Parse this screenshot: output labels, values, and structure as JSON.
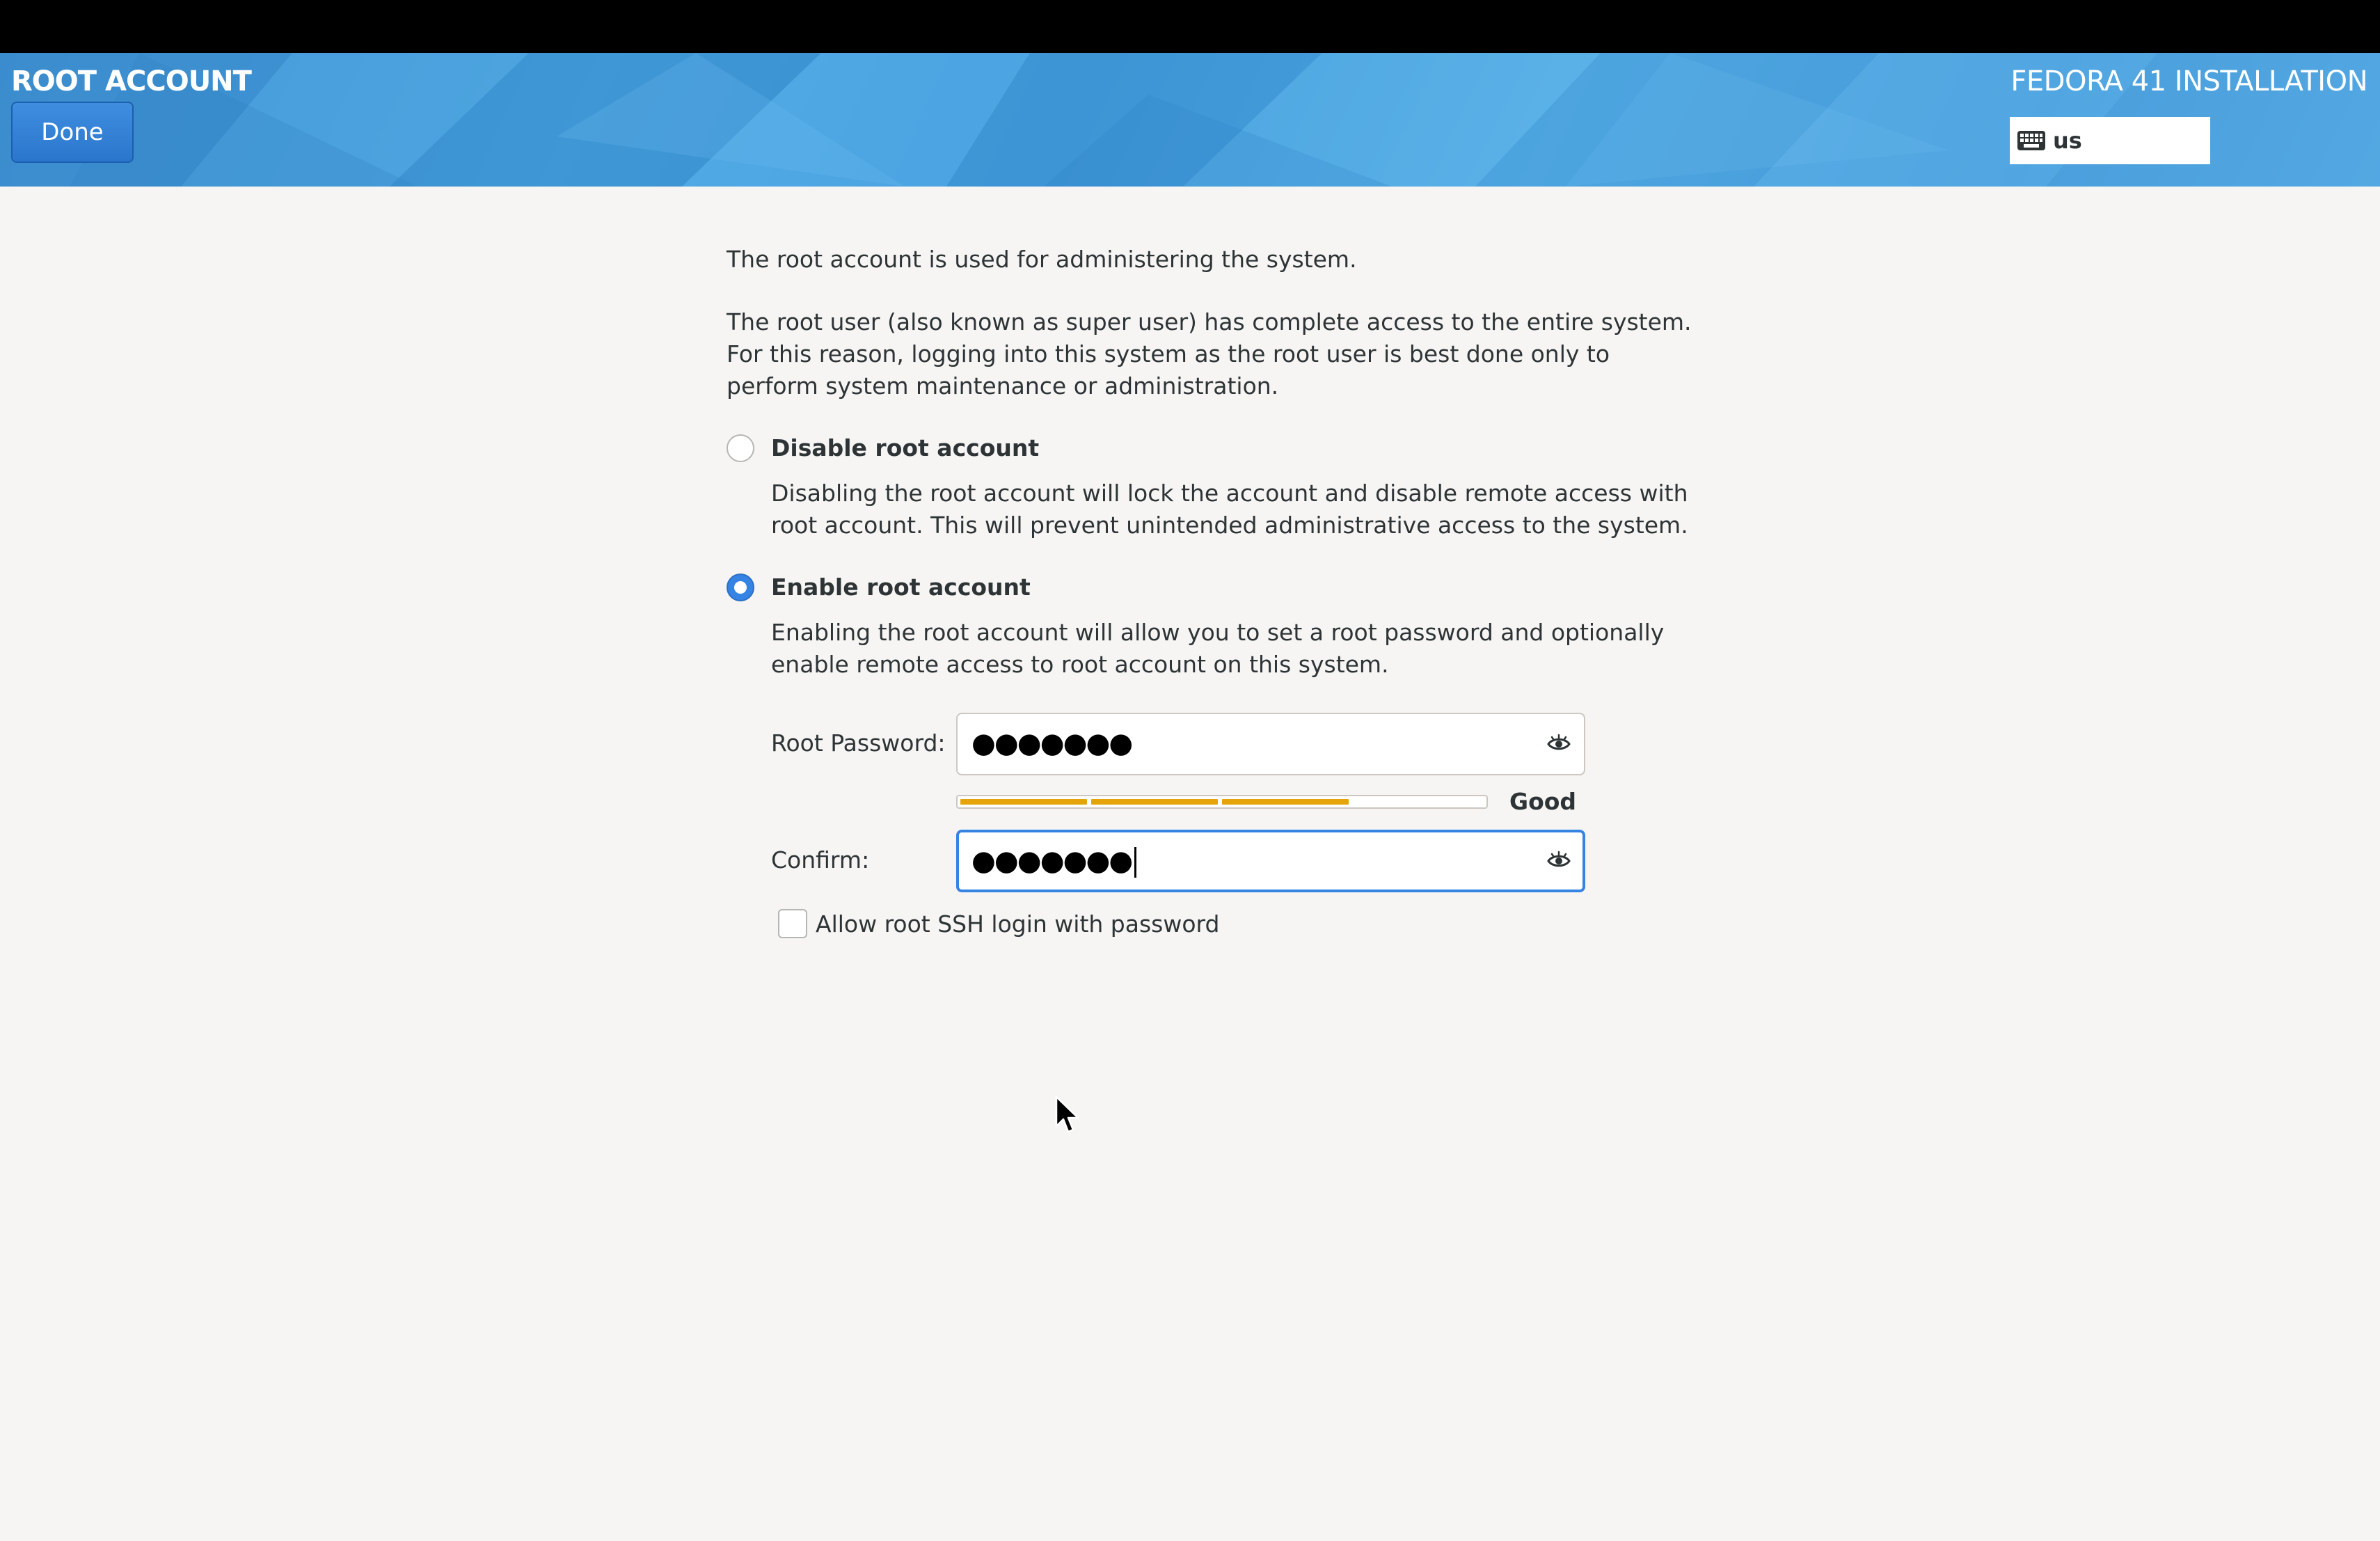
{
  "header": {
    "title": "ROOT ACCOUNT",
    "done_label": "Done",
    "installation_title": "FEDORA 41 INSTALLATION",
    "keyboard_layout": "us",
    "keyboard_icon": "keyboard-icon"
  },
  "intro": {
    "line1": "The root account is used for administering the system.",
    "para2_line1": "The root user (also known as super user) has complete access to the entire system.",
    "para2_line2": "For this reason, logging into this system as the root user is best done only to",
    "para2_line3": "perform system maintenance or administration."
  },
  "options": {
    "disable": {
      "label": "Disable root account",
      "selected": false,
      "desc_line1": "Disabling the root account will lock the account and disable remote access with",
      "desc_line2": "root account. This will prevent unintended administrative access to the system."
    },
    "enable": {
      "label": "Enable root account",
      "selected": true,
      "desc_line1": "Enabling the root account will allow you to set a root password and optionally",
      "desc_line2": "enable remote access to root account on this system."
    }
  },
  "password": {
    "label": "Root Password:",
    "masked_value": "●●●●●●●",
    "strength_label": "Good",
    "strength_segments_filled": 3,
    "strength_segments_total": 4,
    "strength_color": "#e5a50a",
    "reveal_icon": "eye-icon"
  },
  "confirm": {
    "label": "Confirm:",
    "masked_value": "●●●●●●●",
    "focused": true,
    "reveal_icon": "eye-icon"
  },
  "ssh": {
    "label": "Allow root SSH login with password",
    "checked": false
  },
  "colors": {
    "accent": "#3584e4",
    "header_blue": "#4aa4e0",
    "background": "#f6f5f4",
    "strength_bar": "#e5a50a"
  }
}
